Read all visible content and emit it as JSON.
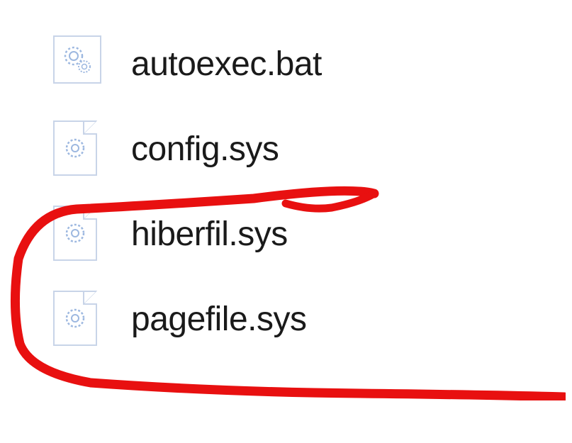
{
  "files": [
    {
      "name": "autoexec.bat",
      "icon": "settings-gear-icon"
    },
    {
      "name": "config.sys",
      "icon": "system-file-icon"
    },
    {
      "name": "hiberfil.sys",
      "icon": "system-file-icon"
    },
    {
      "name": "pagefile.sys",
      "icon": "system-file-icon"
    }
  ],
  "annotation": {
    "color": "#e81010",
    "circles_files": [
      "hiberfil.sys",
      "pagefile.sys"
    ]
  }
}
